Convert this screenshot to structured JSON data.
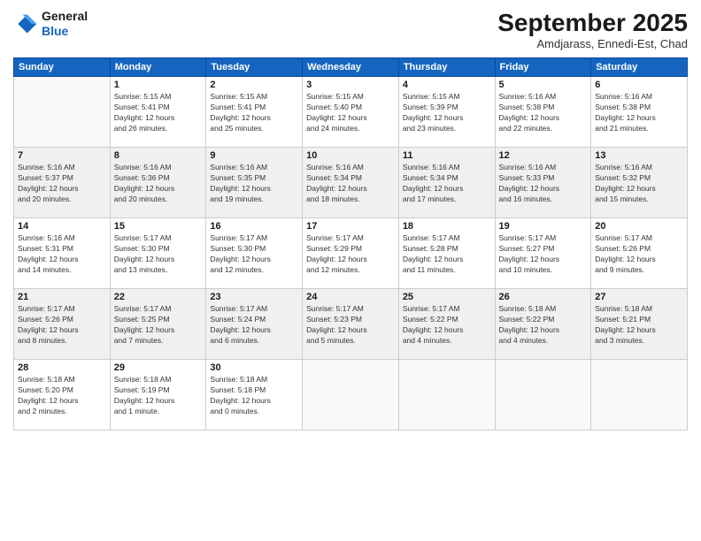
{
  "logo": {
    "line1": "General",
    "line2": "Blue"
  },
  "title": "September 2025",
  "subtitle": "Amdjarass, Ennedi-Est, Chad",
  "days_of_week": [
    "Sunday",
    "Monday",
    "Tuesday",
    "Wednesday",
    "Thursday",
    "Friday",
    "Saturday"
  ],
  "weeks": [
    [
      {
        "num": "",
        "info": ""
      },
      {
        "num": "1",
        "info": "Sunrise: 5:15 AM\nSunset: 5:41 PM\nDaylight: 12 hours\nand 26 minutes."
      },
      {
        "num": "2",
        "info": "Sunrise: 5:15 AM\nSunset: 5:41 PM\nDaylight: 12 hours\nand 25 minutes."
      },
      {
        "num": "3",
        "info": "Sunrise: 5:15 AM\nSunset: 5:40 PM\nDaylight: 12 hours\nand 24 minutes."
      },
      {
        "num": "4",
        "info": "Sunrise: 5:15 AM\nSunset: 5:39 PM\nDaylight: 12 hours\nand 23 minutes."
      },
      {
        "num": "5",
        "info": "Sunrise: 5:16 AM\nSunset: 5:38 PM\nDaylight: 12 hours\nand 22 minutes."
      },
      {
        "num": "6",
        "info": "Sunrise: 5:16 AM\nSunset: 5:38 PM\nDaylight: 12 hours\nand 21 minutes."
      }
    ],
    [
      {
        "num": "7",
        "info": "Sunrise: 5:16 AM\nSunset: 5:37 PM\nDaylight: 12 hours\nand 20 minutes."
      },
      {
        "num": "8",
        "info": "Sunrise: 5:16 AM\nSunset: 5:36 PM\nDaylight: 12 hours\nand 20 minutes."
      },
      {
        "num": "9",
        "info": "Sunrise: 5:16 AM\nSunset: 5:35 PM\nDaylight: 12 hours\nand 19 minutes."
      },
      {
        "num": "10",
        "info": "Sunrise: 5:16 AM\nSunset: 5:34 PM\nDaylight: 12 hours\nand 18 minutes."
      },
      {
        "num": "11",
        "info": "Sunrise: 5:16 AM\nSunset: 5:34 PM\nDaylight: 12 hours\nand 17 minutes."
      },
      {
        "num": "12",
        "info": "Sunrise: 5:16 AM\nSunset: 5:33 PM\nDaylight: 12 hours\nand 16 minutes."
      },
      {
        "num": "13",
        "info": "Sunrise: 5:16 AM\nSunset: 5:32 PM\nDaylight: 12 hours\nand 15 minutes."
      }
    ],
    [
      {
        "num": "14",
        "info": "Sunrise: 5:16 AM\nSunset: 5:31 PM\nDaylight: 12 hours\nand 14 minutes."
      },
      {
        "num": "15",
        "info": "Sunrise: 5:17 AM\nSunset: 5:30 PM\nDaylight: 12 hours\nand 13 minutes."
      },
      {
        "num": "16",
        "info": "Sunrise: 5:17 AM\nSunset: 5:30 PM\nDaylight: 12 hours\nand 12 minutes."
      },
      {
        "num": "17",
        "info": "Sunrise: 5:17 AM\nSunset: 5:29 PM\nDaylight: 12 hours\nand 12 minutes."
      },
      {
        "num": "18",
        "info": "Sunrise: 5:17 AM\nSunset: 5:28 PM\nDaylight: 12 hours\nand 11 minutes."
      },
      {
        "num": "19",
        "info": "Sunrise: 5:17 AM\nSunset: 5:27 PM\nDaylight: 12 hours\nand 10 minutes."
      },
      {
        "num": "20",
        "info": "Sunrise: 5:17 AM\nSunset: 5:26 PM\nDaylight: 12 hours\nand 9 minutes."
      }
    ],
    [
      {
        "num": "21",
        "info": "Sunrise: 5:17 AM\nSunset: 5:26 PM\nDaylight: 12 hours\nand 8 minutes."
      },
      {
        "num": "22",
        "info": "Sunrise: 5:17 AM\nSunset: 5:25 PM\nDaylight: 12 hours\nand 7 minutes."
      },
      {
        "num": "23",
        "info": "Sunrise: 5:17 AM\nSunset: 5:24 PM\nDaylight: 12 hours\nand 6 minutes."
      },
      {
        "num": "24",
        "info": "Sunrise: 5:17 AM\nSunset: 5:23 PM\nDaylight: 12 hours\nand 5 minutes."
      },
      {
        "num": "25",
        "info": "Sunrise: 5:17 AM\nSunset: 5:22 PM\nDaylight: 12 hours\nand 4 minutes."
      },
      {
        "num": "26",
        "info": "Sunrise: 5:18 AM\nSunset: 5:22 PM\nDaylight: 12 hours\nand 4 minutes."
      },
      {
        "num": "27",
        "info": "Sunrise: 5:18 AM\nSunset: 5:21 PM\nDaylight: 12 hours\nand 3 minutes."
      }
    ],
    [
      {
        "num": "28",
        "info": "Sunrise: 5:18 AM\nSunset: 5:20 PM\nDaylight: 12 hours\nand 2 minutes."
      },
      {
        "num": "29",
        "info": "Sunrise: 5:18 AM\nSunset: 5:19 PM\nDaylight: 12 hours\nand 1 minute."
      },
      {
        "num": "30",
        "info": "Sunrise: 5:18 AM\nSunset: 5:18 PM\nDaylight: 12 hours\nand 0 minutes."
      },
      {
        "num": "",
        "info": ""
      },
      {
        "num": "",
        "info": ""
      },
      {
        "num": "",
        "info": ""
      },
      {
        "num": "",
        "info": ""
      }
    ]
  ]
}
